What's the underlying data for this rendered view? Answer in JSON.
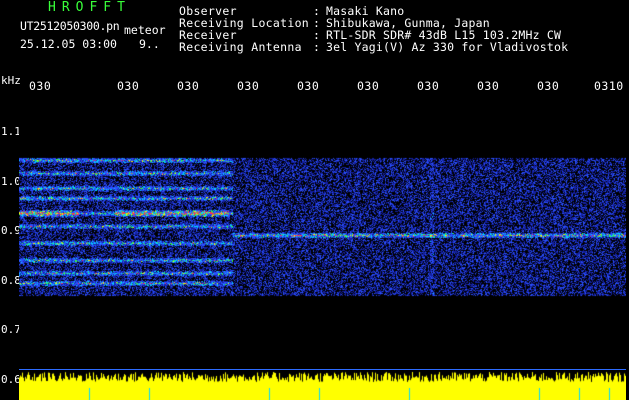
{
  "header": {
    "app_title": "HROFFT",
    "file_name": "UT2512050300.pn",
    "meteor_tag": "meteor",
    "timestamp": "25.12.05 03:00",
    "count": "9.."
  },
  "station_info": [
    {
      "label": "Observer",
      "value": "Masaki Kano"
    },
    {
      "label": "Receiving Location",
      "value": "Shibukawa, Gunma, Japan"
    },
    {
      "label": "Receiver",
      "value": "RTL-SDR SDR# 43dB L15 103.2MHz CW"
    },
    {
      "label": "Receiving Antenna",
      "value": "3el Yagi(V) Az 330 for Vladivostok"
    }
  ],
  "separator": ":",
  "axis": {
    "unit": "kHz",
    "time_ticks": [
      "030",
      "030",
      "030",
      "030",
      "030",
      "030",
      "030",
      "030",
      "030",
      "0310"
    ],
    "freq_ticks": [
      "1.1",
      "1.0",
      "0.9",
      "0.8",
      "0.7",
      "0.6"
    ]
  },
  "colors": {
    "title_green": "#39ff3a",
    "background": "#000000",
    "text": "#ffffff",
    "signal_red": "#ff2a55",
    "signal_yellow": "#ffee00",
    "noise_blue": "#1a2aff",
    "level_yellow": "#ffff00",
    "level_cyan": "#00d8ff"
  }
}
